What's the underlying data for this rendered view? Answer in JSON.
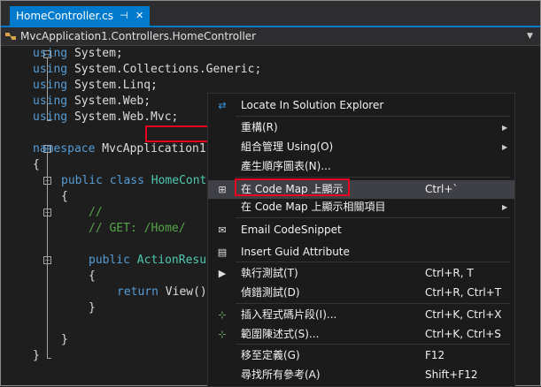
{
  "tab": {
    "title": "HomeController.cs",
    "pin": "⊣",
    "close": "✕"
  },
  "navbar": {
    "path": "MvcApplication1.Controllers.HomeController",
    "chevron": "▼"
  },
  "code": {
    "line1": [
      "using",
      " System;"
    ],
    "line2": [
      "using",
      " System.Collections.Generic;"
    ],
    "line3": [
      "using",
      " System.Linq;"
    ],
    "line4": [
      "using",
      " System.Web;"
    ],
    "line5": [
      "using",
      " System.Web.Mvc;"
    ],
    "line7": [
      "namespace",
      " MvcApplication1"
    ],
    "line8": "{",
    "line9": [
      "public",
      " ",
      "class",
      " ",
      "HomeCont"
    ],
    "line10": "{",
    "line11": "//",
    "line12": "// GET: /Home/",
    "line14": [
      "public",
      " ",
      "ActionResu"
    ],
    "line15": "{",
    "line16": [
      "return",
      " View()"
    ],
    "line17": "}",
    "line19": "}",
    "line20": "}"
  },
  "menu": {
    "items": [
      {
        "icon": "locate-icon",
        "glyph": "⇄",
        "label": "Locate In Solution Explorer",
        "shortcut": "",
        "submenu": false
      },
      {
        "icon": "",
        "glyph": "",
        "label": "重構(R)",
        "shortcut": "",
        "submenu": true
      },
      {
        "icon": "",
        "glyph": "",
        "label": "組合管理 Using(O)",
        "shortcut": "",
        "submenu": true
      },
      {
        "icon": "",
        "glyph": "",
        "label": "產生順序圖表(N)...",
        "shortcut": "",
        "submenu": false
      },
      {
        "icon": "code-map-icon",
        "glyph": "⊞",
        "label": "在 Code Map 上顯示",
        "shortcut": "Ctrl+`",
        "submenu": false
      },
      {
        "icon": "",
        "glyph": "",
        "label": "在 Code Map 上顯示相關項目",
        "shortcut": "",
        "submenu": true
      },
      {
        "icon": "email-icon",
        "glyph": "✉",
        "label": "Email CodeSnippet",
        "shortcut": "",
        "submenu": false
      },
      {
        "icon": "guid-icon",
        "glyph": "▤",
        "label": "Insert Guid Attribute",
        "shortcut": "",
        "submenu": false
      },
      {
        "icon": "run-tests-icon",
        "glyph": "▶",
        "label": "執行測試(T)",
        "shortcut": "Ctrl+R, T",
        "submenu": false
      },
      {
        "icon": "debug-tests-icon",
        "glyph": "",
        "label": "偵錯測試(D)",
        "shortcut": "Ctrl+R, Ctrl+T",
        "submenu": false
      },
      {
        "icon": "insert-snippet-icon",
        "glyph": "⊹",
        "label": "插入程式碼片段(I)...",
        "shortcut": "Ctrl+K, Ctrl+X",
        "submenu": false
      },
      {
        "icon": "surround-with-icon",
        "glyph": "⊹",
        "label": "範圍陳述式(S)...",
        "shortcut": "Ctrl+K, Ctrl+S",
        "submenu": false
      },
      {
        "icon": "",
        "glyph": "",
        "label": "移至定義(G)",
        "shortcut": "F12",
        "submenu": false
      },
      {
        "icon": "",
        "glyph": "",
        "label": "尋找所有參考(A)",
        "shortcut": "Shift+F12",
        "submenu": false
      }
    ]
  },
  "colors": {
    "accent": "#007acc",
    "highlight_red": "#e8001c",
    "menu_bg": "#1b1b1c",
    "editor_bg": "#1e1e1e"
  }
}
